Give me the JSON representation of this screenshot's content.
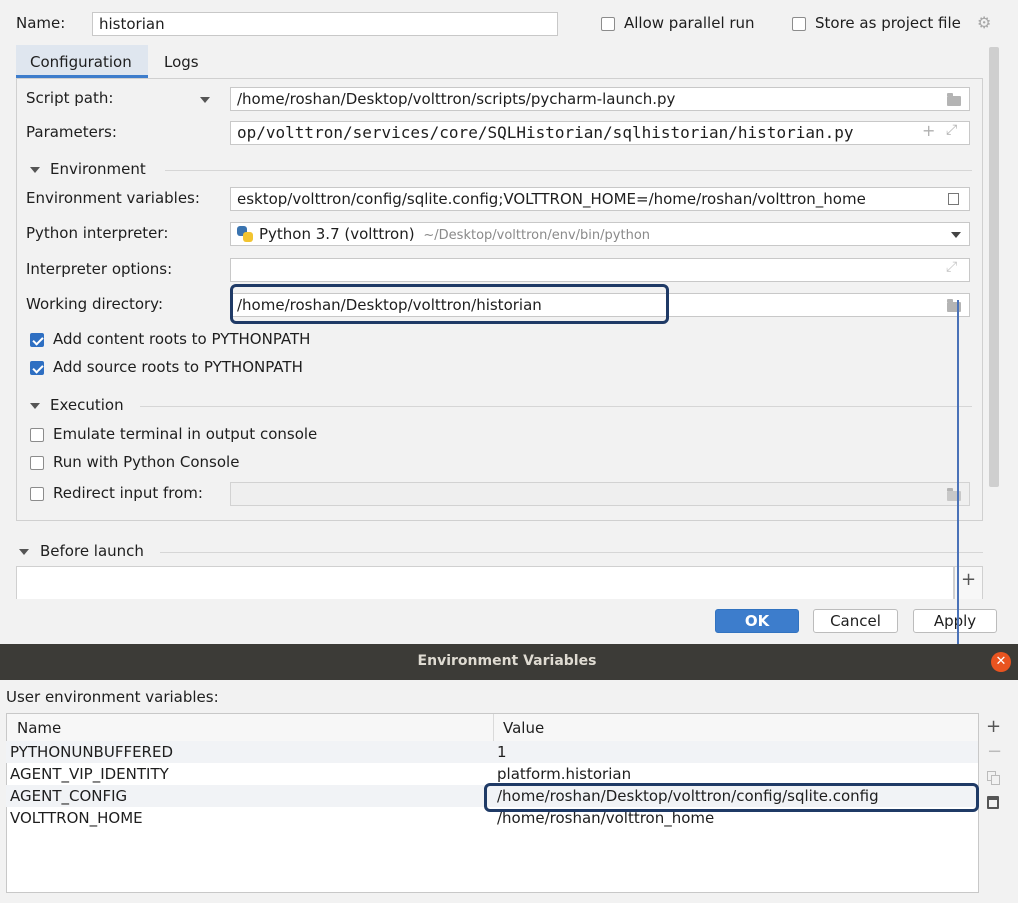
{
  "run_config": {
    "name_label": "Name:",
    "name_value": "historian",
    "allow_parallel_label": "Allow parallel run",
    "store_project_label": "Store as project file",
    "tabs": [
      {
        "label": "Configuration"
      },
      {
        "label": "Logs"
      }
    ],
    "script_path_label": "Script path:",
    "script_path_value": "/home/roshan/Desktop/volttron/scripts/pycharm-launch.py",
    "parameters_label": "Parameters:",
    "parameters_value": "op/volttron/services/core/SQLHistorian/sqlhistorian/historian.py",
    "environment_section": "Environment",
    "env_vars_label": "Environment variables:",
    "env_vars_value": "esktop/volttron/config/sqlite.config;VOLTTRON_HOME=/home/roshan/volttron_home",
    "interpreter_label": "Python interpreter:",
    "interpreter_name": "Python 3.7 (volttron)",
    "interpreter_path": "~/Desktop/volttron/env/bin/python",
    "interp_options_label": "Interpreter options:",
    "interp_options_value": "",
    "working_dir_label": "Working directory:",
    "working_dir_value": "/home/roshan/Desktop/volttron/historian",
    "content_roots_label": "Add content roots to PYTHONPATH",
    "source_roots_label": "Add source roots to PYTHONPATH",
    "execution_section": "Execution",
    "emulate_terminal_label": "Emulate terminal in output console",
    "python_console_label": "Run with Python Console",
    "redirect_input_label": "Redirect input from:",
    "before_launch_section": "Before launch",
    "ok_label": "OK",
    "cancel_label": "Cancel",
    "apply_label": "Apply",
    "checkboxes": {
      "allow_parallel": false,
      "store_project": false,
      "content_roots": true,
      "source_roots": true,
      "emulate_terminal": false,
      "python_console": false,
      "redirect_input": false
    }
  },
  "env_dialog": {
    "title": "Environment Variables",
    "user_vars_label": "User environment variables:",
    "columns": [
      "Name",
      "Value"
    ],
    "rows": [
      {
        "name": "PYTHONUNBUFFERED",
        "value": "1"
      },
      {
        "name": "AGENT_VIP_IDENTITY",
        "value": "platform.historian"
      },
      {
        "name": "AGENT_CONFIG",
        "value": "/home/roshan/Desktop/volttron/config/sqlite.config"
      },
      {
        "name": "VOLTTRON_HOME",
        "value": "/home/roshan/volttron_home"
      }
    ]
  },
  "icons": {
    "gear": "gear-icon",
    "dropdown": "chevron-down-icon",
    "folder": "folder-icon",
    "expand": "expand-icon",
    "add": "plus-icon",
    "python": "python-icon",
    "close": "close-icon",
    "copy": "copy-icon",
    "paste": "paste-icon",
    "remove": "minus-icon"
  },
  "colors": {
    "accent": "#3d7dcc",
    "highlight_border": "#1f3a66",
    "dialog_title_bg": "#3c3b37",
    "close_button": "#e95420"
  }
}
